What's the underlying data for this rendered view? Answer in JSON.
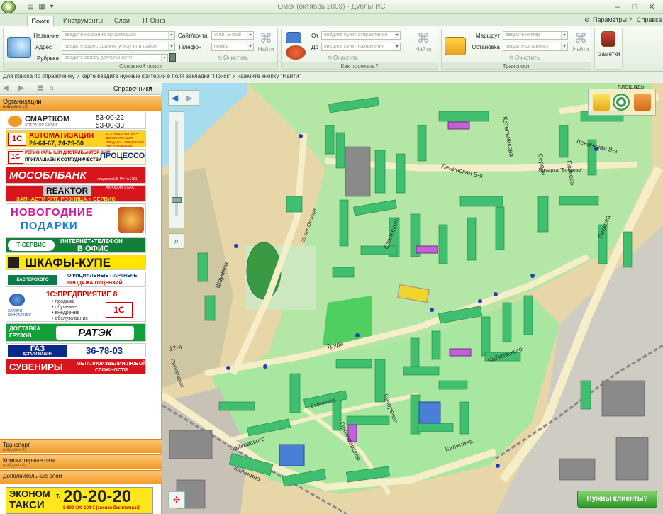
{
  "window": {
    "title": "Омск (октябрь 2009) - ДубльГИС"
  },
  "tabs": [
    "Поиск",
    "Инструменты",
    "Слои",
    "IT Окна"
  ],
  "top_links": {
    "params": "Параметры",
    "help": "Справка"
  },
  "ribbon": {
    "search": {
      "labels": {
        "name": "Название",
        "address": "Адрес",
        "rubric": "Рубрика",
        "site": "Сайт/почта",
        "phone": "Телефон"
      },
      "placeholders": {
        "name": "введите название организации",
        "address": "введите адрес здания, улицу или район",
        "rubric": "введите сферу деятельности",
        "site": "Web, E-mail",
        "phone": "номер"
      },
      "clear": "Очистить",
      "find": "Найти",
      "group_title": "Основной поиск"
    },
    "route": {
      "labels": {
        "from": "От",
        "to": "До"
      },
      "placeholders": {
        "from": "введите пункт отправления",
        "to": "введите пункт назначения"
      },
      "clear": "Очистить",
      "find": "Найти",
      "group_title": "Как проехать?"
    },
    "transport": {
      "labels": {
        "route": "Маршрут",
        "stop": "Остановка"
      },
      "placeholders": {
        "route": "введите номер",
        "stop": "введите остановку"
      },
      "clear": "Очистить",
      "find": "Найти",
      "group_title": "Транспорт"
    },
    "notes": "Заметки"
  },
  "hint": "Для поиска по справочнику и карте введите нужные критерии в поля закладки \"Поиск\" и нажмите кнопку \"Найти\"",
  "left": {
    "directories": "Справочники",
    "orgs": {
      "title": "Организации",
      "found": "(найдено 13)"
    },
    "ads": {
      "smartcom": {
        "name": "СМАРТКОМ",
        "sub": "ОПЕРАТОР СВЯЗИ",
        "phone1": "53-00-22",
        "phone2": "53-00-33"
      },
      "auto": {
        "title": "АВТОМАТИЗАЦИЯ",
        "phones": "24-64-67, 24-29-50",
        "side": "1С: ПРЕДПРИЯТИЕ • ДЕМОНСТРАЦИЯ ПРОДАЖА • ВНЕДРЕНИЕ ОБСЛУЖИВАНИЕ"
      },
      "proc": {
        "line1": "РЕГИОНАЛЬНЫЙ ДИСТРИБЬЮТОР \"1С\"",
        "line2": "ПРИГЛАШАЕМ К СОТРУДНИЧЕСТВУ",
        "brand": "ПРОЦЕССОР"
      },
      "bank": {
        "name": "МОСОБЛБАНК",
        "sub": "лицензия ЦБ РФ №1751"
      },
      "reaktor": {
        "name": "REAKTOR",
        "sub": "ЗАПЧАСТИ ОПТ, РОЗНИЦА + СЕРВИС",
        "tag": "АВТОКОМПЛЕКС"
      },
      "gifts": {
        "line1": "НОВОГОДНИЕ",
        "line2": "ПОДАРКИ"
      },
      "tservice": {
        "logo": "Т-СЕРВИС",
        "line1": "ИНТЕРНЕТ+ТЕЛЕФОН",
        "line2": "В ОФИС"
      },
      "wardrobes": {
        "text": "ШКАФЫ-КУПЕ"
      },
      "kaspersky": {
        "logo": "КАСПЕРСКОГО",
        "line1": "ОФИЦИАЛЬНЫЕ ПАРТНЕРЫ",
        "line2": "ПРОДАЖА ЛИЦЕНЗИЙ"
      },
      "sator": {
        "title": "1С:ПРЕДПРИЯТИЕ 8",
        "items": [
          "• продажа",
          "• обучение",
          "• внедрение",
          "• обслуживание"
        ],
        "logo": "САТОРИ КОНСАЛТИНГ"
      },
      "delivery": {
        "left": "ДОСТАВКА ГРУЗОВ",
        "brand": "РАТЭК"
      },
      "gaz": {
        "brand": "ГАЗ",
        "sub": "ДЕТАЛИ МАШИН",
        "phone": "36-78-03"
      },
      "souvenir": {
        "left": "СУВЕНИРЫ",
        "right": "МЕТАЛЛОИЗДЕЛИЯ ЛЮБОЙ СЛОЖНОСТИ"
      }
    },
    "sections": [
      {
        "title": "Транспорт",
        "found": "(найдено 0)"
      },
      {
        "title": "Компьютерные сети",
        "found": "(найдено 0)"
      },
      {
        "title": "Дополнительные слои",
        "found": ""
      }
    ],
    "taxi": {
      "line1": "ЭКОНОМ",
      "line2": "ТАКСИ",
      "big": "20-20-20",
      "prefix": "т.",
      "sub": "8-800-100-100-3 (звонок бесплатный)"
    }
  },
  "map": {
    "streets": [
      "Ленинская 9-я",
      "Ленинская 8-я",
      "Котельникова",
      "Серова",
      "Пойкова",
      "Лескова",
      "Шаумяна",
      "Труда",
      "Чайковского",
      "Калинина",
      "Пролетарская",
      "Кучеренко",
      "Стальского",
      "25 лет Октября",
      "Бабушкина",
      "Пригородная",
      "Ярмарка \"Бобкова\"",
      "площадь",
      "12-я"
    ],
    "client_button": "Нужны клиенты?"
  },
  "colors": {
    "accent": "#f29a25",
    "map_green": "#a7e7a0",
    "building": "#3fbf6f",
    "road": "#f6eec8",
    "water": "#a6dced",
    "stop_dot": "#1f3fbf"
  }
}
